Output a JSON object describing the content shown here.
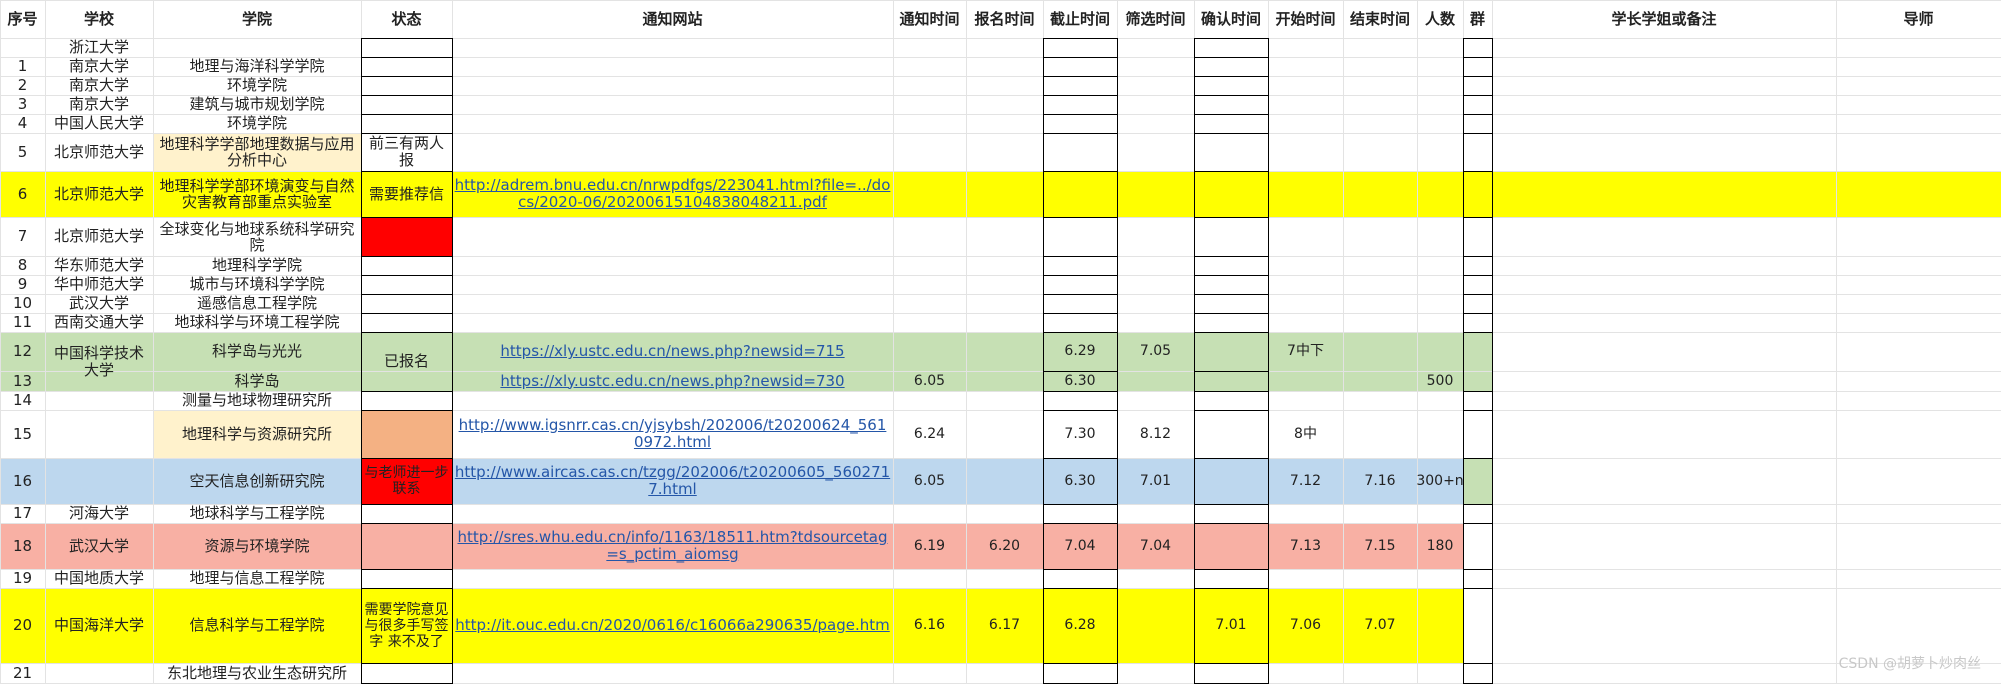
{
  "headers": [
    "序号",
    "学校",
    "学院",
    "状态",
    "通知网站",
    "通知时间",
    "报名时间",
    "截止时间",
    "筛选时间",
    "确认时间",
    "开始时间",
    "结束时间",
    "人数",
    "群",
    "学长学姐或备注",
    "导师"
  ],
  "rows": [
    {
      "no": "",
      "school": "浙江大学",
      "college": ""
    },
    {
      "no": "1",
      "school": "南京大学",
      "college": "地理与海洋科学学院"
    },
    {
      "no": "2",
      "school": "南京大学",
      "college": "环境学院"
    },
    {
      "no": "3",
      "school": "南京大学",
      "college": "建筑与城市规划学院"
    },
    {
      "no": "4",
      "school": "中国人民大学",
      "college": "环境学院"
    },
    {
      "no": "5",
      "school": "北京师范大学",
      "college": "地理科学学部地理数据与应用分析中心",
      "status": "前三有两人报"
    },
    {
      "no": "6",
      "school": "北京师范大学",
      "college": "地理科学学部环境演变与自然灾害教育部重点实验室",
      "status": "需要推荐信",
      "url": "http://adrem.bnu.edu.cn/nrwpdfgs/223041.html?file=../docs/2020-06/20200615104838048211.pdf"
    },
    {
      "no": "7",
      "school": "北京师范大学",
      "college": "全球变化与地球系统科学研究院"
    },
    {
      "no": "8",
      "school": "华东师范大学",
      "college": "地理科学学院"
    },
    {
      "no": "9",
      "school": "华中师范大学",
      "college": "城市与环境科学学院"
    },
    {
      "no": "10",
      "school": "武汉大学",
      "college": "遥感信息工程学院"
    },
    {
      "no": "11",
      "school": "西南交通大学",
      "college": "地球科学与环境工程学院"
    },
    {
      "no": "12",
      "school": "中国科学技术大学",
      "college": "科学岛与光光",
      "status": "已报名",
      "url": "https://xly.ustc.edu.cn/news.php?newsid=715",
      "deadline": "6.29",
      "screen": "7.05",
      "start": "7中下"
    },
    {
      "no": "13",
      "school": "",
      "college": "科学岛",
      "url": "https://xly.ustc.edu.cn/news.php?newsid=730",
      "notice": "6.05",
      "deadline": "6.30",
      "count": "500"
    },
    {
      "no": "14",
      "school": "",
      "college": "测量与地球物理研究所"
    },
    {
      "no": "15",
      "school": "",
      "college": "地理科学与资源研究所",
      "url": "http://www.igsnrr.cas.cn/yjsybsh/202006/t20200624_5610972.html",
      "notice": "6.24",
      "deadline": "7.30",
      "screen": "8.12",
      "start": "8中"
    },
    {
      "no": "16",
      "school": "",
      "college": "空天信息创新研究院",
      "status": "与老师进一步联系",
      "url": "http://www.aircas.cas.cn/tzgg/202006/t20200605_5602717.html",
      "notice": "6.05",
      "deadline": "6.30",
      "screen": "7.01",
      "start": "7.12",
      "end": "7.16",
      "count": "300+n"
    },
    {
      "no": "17",
      "school": "河海大学",
      "college": "地球科学与工程学院"
    },
    {
      "no": "18",
      "school": "武汉大学",
      "college": "资源与环境学院",
      "url": "http://sres.whu.edu.cn/info/1163/18511.htm?tdsourcetag=s_pctim_aiomsg",
      "notice": "6.19",
      "register": "6.20",
      "deadline": "7.04",
      "screen": "7.04",
      "start": "7.13",
      "end": "7.15",
      "count": "180"
    },
    {
      "no": "19",
      "school": "中国地质大学",
      "college": "地理与信息工程学院"
    },
    {
      "no": "20",
      "school": "中国海洋大学",
      "college": "信息科学与工程学院",
      "status": "需要学院意见与很多手写签字 来不及了",
      "url": "http://it.ouc.edu.cn/2020/0616/c16066a290635/page.htm",
      "notice": "6.16",
      "register": "6.17",
      "deadline": "6.28",
      "confirm": "7.01",
      "start": "7.06",
      "end": "7.07"
    },
    {
      "no": "21",
      "school": "",
      "college": "东北地理与农业生态研究所"
    }
  ],
  "colors": {
    "yellow": "#ffff00",
    "green": "#c6e0b4",
    "peach": "#fff2cc",
    "orange": "#f4b183",
    "blue": "#bdd7ee",
    "salmon": "#f8b0a4",
    "red": "#ff0000",
    "link": "#2456a8"
  },
  "watermark": "CSDN @胡萝卜炒肉丝"
}
